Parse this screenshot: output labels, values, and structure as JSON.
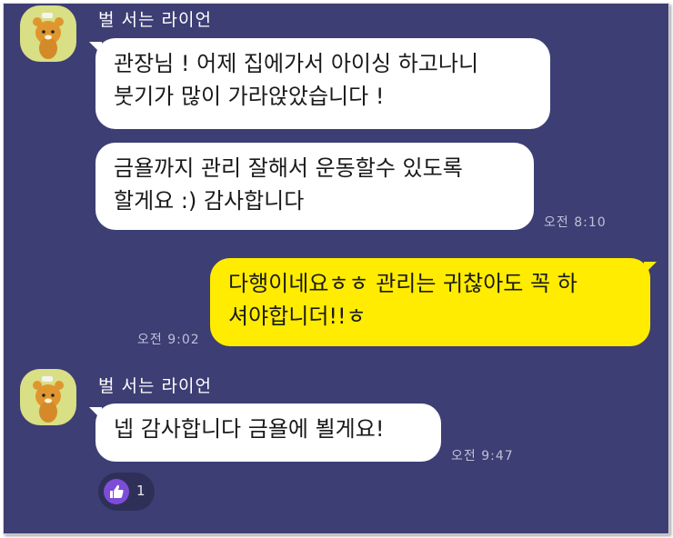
{
  "chat": {
    "sender_name": "벌 서는 라이언",
    "messages": [
      {
        "lines": [
          "관장님 ! 어제 집에가서 아이싱 하고나니",
          "붓기가 많이 가라앉았습니다 !"
        ]
      },
      {
        "lines": [
          "금욜까지 관리 잘해서 운동할수 있도록",
          "할게요 :) 감사합니다"
        ],
        "time": "오전 8:10"
      },
      {
        "lines": [
          "다행이네요ㅎㅎ 관리는 귀찮아도 꼭 하",
          "셔야합니더!!ㅎ"
        ],
        "time": "오전 9:02"
      },
      {
        "lines": [
          "넵 감사합니다 금욜에 뵐게요!"
        ],
        "time": "오전 9:47"
      }
    ],
    "reaction": {
      "icon": "thumbs-up-icon",
      "count": "1"
    }
  },
  "colors": {
    "background": "#3d3e74",
    "my_bubble": "#ffec00",
    "other_bubble": "#ffffff",
    "reaction_icon": "#7d4dd8",
    "avatar_bg": "#d9df84"
  }
}
